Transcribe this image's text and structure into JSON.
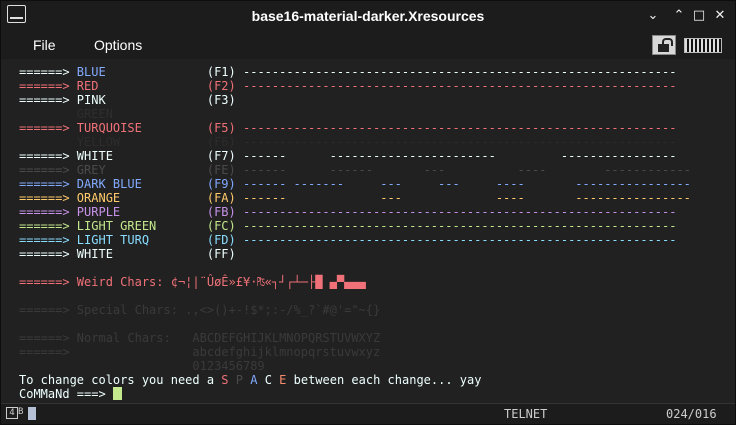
{
  "window": {
    "title": "base16-material-darker.Xresources"
  },
  "window_controls": {
    "minimize": "⌄",
    "maximize": "⌃",
    "restore": "□",
    "close": "✕"
  },
  "menu": [
    {
      "label": "File"
    },
    {
      "label": "Options"
    }
  ],
  "colors": {
    "background": "#212121",
    "chrome": "#1c1c1c",
    "text": "#eeffff",
    "blue": "#82aaff",
    "red": "#f07178",
    "turquoise": "#89ddff",
    "orange": "#f78c6c",
    "purple": "#c792ea",
    "green": "#c3e88d",
    "dim": "#4a4a4a",
    "yellow": "#ffcb6b"
  },
  "rows": [
    {
      "segs": [
        {
          "t": "======> ",
          "c": "#eeffff"
        },
        {
          "t": "BLUE",
          "c": "#82aaff"
        },
        {
          "t": "              ",
          "c": "#eeffff"
        },
        {
          "t": "(F1)",
          "c": "#eeffff"
        },
        {
          "t": " ------------------------------------------------------------",
          "c": "#eeffff"
        }
      ]
    },
    {
      "segs": [
        {
          "t": "======> RED               (F2) ------------------------------------------------------------",
          "c": "#f07178"
        }
      ]
    },
    {
      "segs": [
        {
          "t": "======> PINK              (F3)",
          "c": "#eeffff"
        }
      ]
    },
    {
      "segs": [
        {
          "t": "        GREEN",
          "c": "#2e2e2e"
        }
      ]
    },
    {
      "segs": [
        {
          "t": "======> TURQUOISE         (F5) ------------------------------------------------------------",
          "c": "#f07178"
        }
      ]
    },
    {
      "segs": [
        {
          "t": "        YELLOW            (F6) ------------------------------------------------------------",
          "c": "#2c2c2c"
        }
      ]
    },
    {
      "segs": [
        {
          "t": "======> WHITE             (F7) ------      -----------------------         ----------------",
          "c": "#eeffff"
        }
      ]
    },
    {
      "segs": [
        {
          "t": "======> GREY              (FE) ------      ------       ---          ----        ------------",
          "c": "#4a4a4a"
        }
      ]
    },
    {
      "segs": [
        {
          "t": "======> DARK BLUE         (F9) ------ -------     ---     ---     ----       ----------------",
          "c": "#82aaff"
        }
      ]
    },
    {
      "segs": [
        {
          "t": "======> ORANGE            (FA) ------             ---             ----       ----------------",
          "c": "#ffcb6b"
        }
      ]
    },
    {
      "segs": [
        {
          "t": "======> PURPLE            (FB) ------------------------------------------------------------",
          "c": "#c792ea"
        }
      ]
    },
    {
      "segs": [
        {
          "t": "======> LIGHT GREEN       (FC) ------------------------------------------------------------",
          "c": "#c3e88d"
        }
      ]
    },
    {
      "segs": [
        {
          "t": "======> LIGHT TURQ        (FD) ------------------------------------------------------------",
          "c": "#89ddff"
        }
      ]
    },
    {
      "segs": [
        {
          "t": "======> WHITE             (FF)",
          "c": "#eeffff"
        }
      ]
    },
    {
      "segs": [
        {
          "t": " ",
          "c": "#eeffff"
        }
      ]
    },
    {
      "segs": [
        {
          "t": "======> Weird Chars: ¢¬¦|¨ÛøÊ»£¥·₧«┐┘┌┴─├█ ▄▀▄▄▄",
          "c": "#f07178"
        }
      ]
    },
    {
      "segs": [
        {
          "t": " ",
          "c": "#eeffff"
        }
      ]
    },
    {
      "segs": [
        {
          "t": "======> Special Chars: .,<>()+-!$*;:-/%_?`#@'=\"~{}",
          "c": "#3a3a3a"
        }
      ]
    },
    {
      "segs": [
        {
          "t": " ",
          "c": "#eeffff"
        }
      ]
    },
    {
      "segs": [
        {
          "t": "======> Normal Chars:   ABCDEFGHIJKLMNOPQRSTUVWXYZ",
          "c": "#3a3a3a"
        }
      ]
    },
    {
      "segs": [
        {
          "t": "======>                 abcdefghijklmnopqrstuvwxyz",
          "c": "#3a3a3a"
        }
      ]
    },
    {
      "segs": [
        {
          "t": "                        0123456789",
          "c": "#3a3a3a"
        }
      ]
    },
    {
      "segs": [
        {
          "t": "To change colors you need a ",
          "c": "#eeffff"
        },
        {
          "t": "S",
          "c": "#f07178"
        },
        {
          "t": " ",
          "c": "#eeffff"
        },
        {
          "t": "P",
          "c": "#4a4a4a"
        },
        {
          "t": " ",
          "c": "#eeffff"
        },
        {
          "t": "A",
          "c": "#82aaff"
        },
        {
          "t": " ",
          "c": "#eeffff"
        },
        {
          "t": "C",
          "c": "#eeffff"
        },
        {
          "t": " ",
          "c": "#eeffff"
        },
        {
          "t": "E",
          "c": "#f78c6c"
        },
        {
          "t": " between each change... yay",
          "c": "#eeffff"
        }
      ]
    },
    {
      "segs": [
        {
          "t": "CoMMaNd ===> ",
          "c": "#eeffff"
        }
      ],
      "cursor": true
    }
  ],
  "status": {
    "icon1": "4",
    "icon2": "B",
    "mode": "TELNET",
    "position": "024/016"
  }
}
